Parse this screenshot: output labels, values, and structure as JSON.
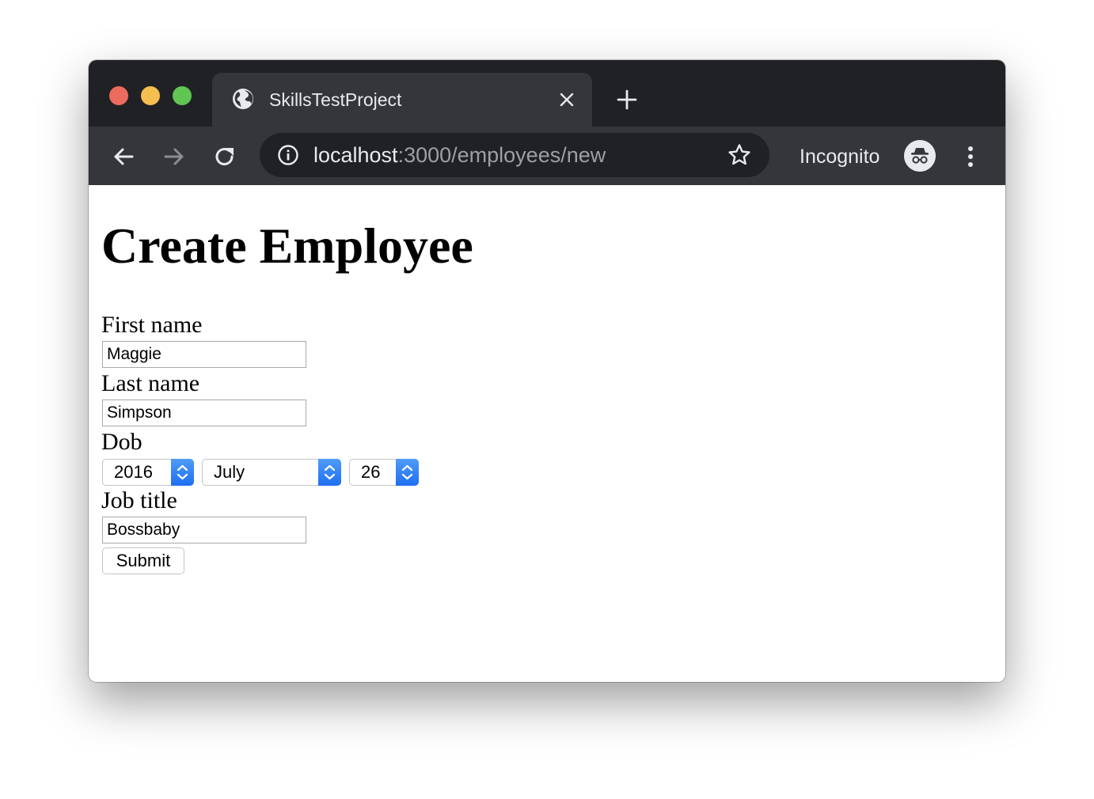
{
  "browser": {
    "tab": {
      "title": "SkillsTestProject"
    },
    "address_bar": {
      "host": "localhost",
      "path": ":3000/employees/new"
    },
    "profile": {
      "label": "Incognito"
    },
    "icons": [
      "globe-icon",
      "close-icon",
      "plus-icon",
      "back-arrow-icon",
      "forward-arrow-icon",
      "reload-icon",
      "info-icon",
      "star-icon",
      "incognito-icon",
      "more-vert-icon"
    ],
    "colors": {
      "frame": "#202124",
      "toolbar": "#35363a",
      "tab": "#35363a",
      "text": "#e8eaed",
      "muted": "#9aa0a6"
    }
  },
  "page": {
    "title": "Create Employee",
    "form": {
      "first_name": {
        "label": "First name",
        "value": "Maggie"
      },
      "last_name": {
        "label": "Last name",
        "value": "Simpson"
      },
      "dob": {
        "label": "Dob",
        "year": "2016",
        "month": "July",
        "day": "26"
      },
      "job_title": {
        "label": "Job title",
        "value": "Bossbaby"
      },
      "submit_label": "Submit"
    },
    "colors": {
      "select_accent": "#3b82f6"
    }
  }
}
